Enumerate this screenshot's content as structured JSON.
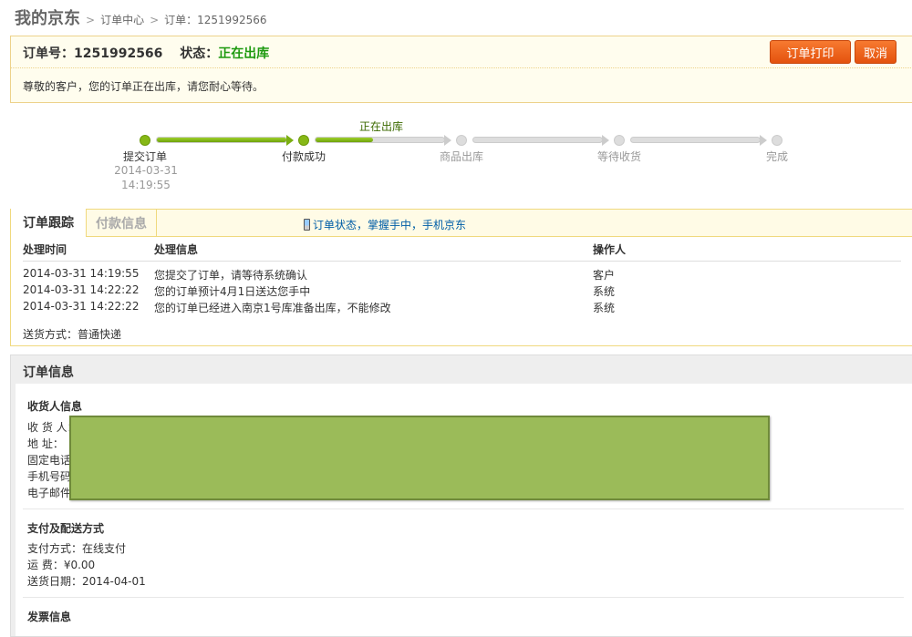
{
  "breadcrumb": {
    "home": "我的京东",
    "center": "订单中心",
    "order": "订单：1251992566"
  },
  "order_header": {
    "order_no_label": "订单号：",
    "order_no": "1251992566",
    "status_label": "状态：",
    "status": "正在出库",
    "message": "尊敬的客户，您的订单正在出库，请您耐心等待。",
    "print_button": "订单打印",
    "cancel_button": "取消",
    "status_color": "#1e9a10",
    "button_color": "#ee6215"
  },
  "progress": {
    "current_label": "正在出库",
    "current_step_fraction": 0.45,
    "steps": [
      {
        "label": "提交订单",
        "done": true,
        "date": "2014-03-31",
        "time": "14:19:55"
      },
      {
        "label": "付款成功",
        "done": true
      },
      {
        "label": "商品出库",
        "done": false
      },
      {
        "label": "等待收货",
        "done": false
      },
      {
        "label": "完成",
        "done": false
      }
    ]
  },
  "tracking": {
    "tabs": [
      "订单跟踪",
      "付款信息"
    ],
    "mobile_link": "订单状态，掌握手中，手机京东",
    "columns": [
      "处理时间",
      "处理信息",
      "操作人"
    ],
    "rows": [
      {
        "time": "2014-03-31 14:19:55",
        "info": "您提交了订单，请等待系统确认",
        "operator": "客户"
      },
      {
        "time": "2014-03-31 14:22:22",
        "info": "您的订单预计4月1日送达您手中",
        "operator": "系统"
      },
      {
        "time": "2014-03-31 14:22:22",
        "info": "您的订单已经进入南京1号库准备出库，不能修改",
        "operator": "系统"
      }
    ],
    "shipping": "送货方式：普通快递"
  },
  "order_info": {
    "title": "订单信息",
    "consignee": {
      "title": "收货人信息",
      "labels": [
        "收 货 人：",
        "地    址：",
        "固定电话：",
        "手机号码：",
        "电子邮件："
      ]
    },
    "payment": {
      "title": "支付及配送方式",
      "method": "支付方式：在线支付",
      "fee_label": "运    费：",
      "fee": "¥0.00",
      "date_label": "送货日期：",
      "date": "2014-04-01"
    },
    "invoice": {
      "title": "发票信息"
    }
  }
}
